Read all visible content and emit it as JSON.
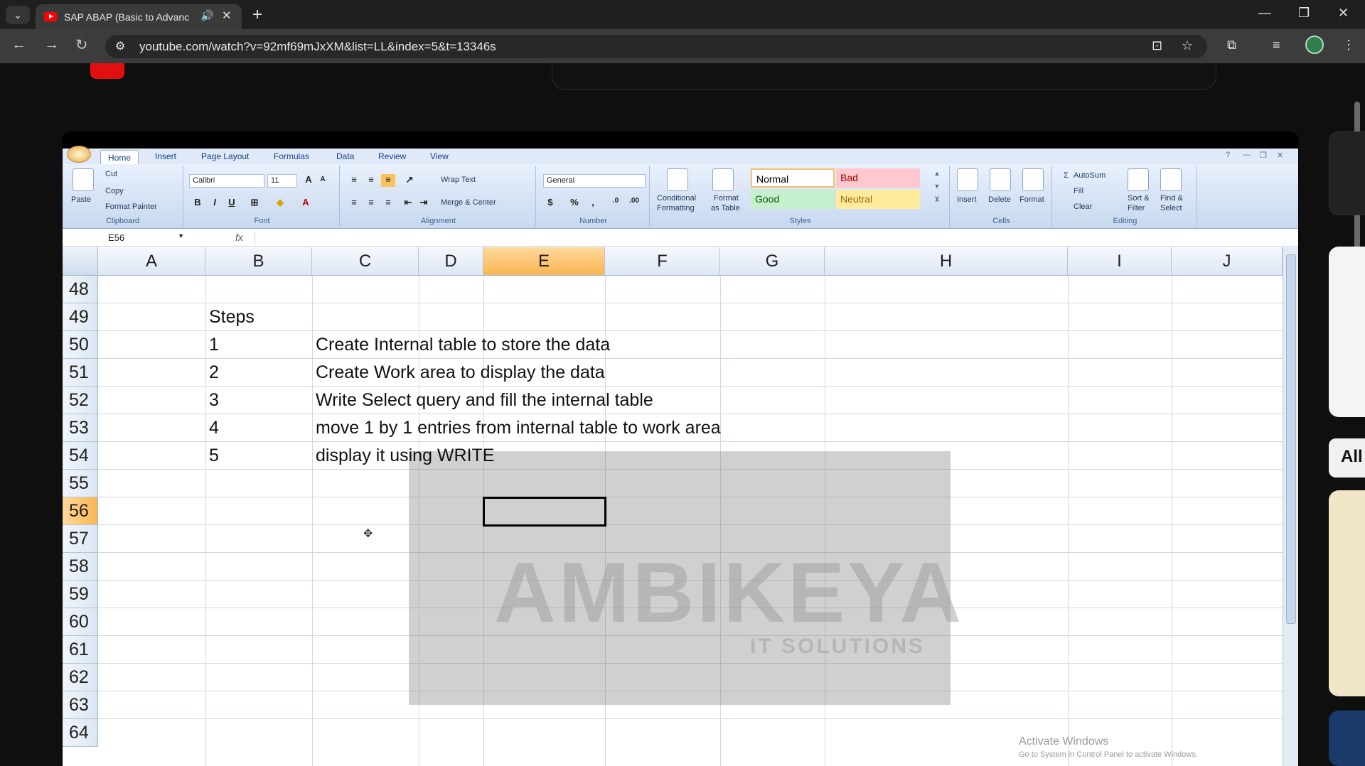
{
  "browser": {
    "tab_title": "SAP ABAP (Basic to Advanc",
    "url": "youtube.com/watch?v=92mf69mJxXM&list=LL&index=5&t=13346s"
  },
  "excel": {
    "tabs": [
      "Home",
      "Insert",
      "Page Layout",
      "Formulas",
      "Data",
      "Review",
      "View"
    ],
    "clipboard": {
      "paste": "Paste",
      "cut": "Cut",
      "copy": "Copy",
      "format_painter": "Format Painter",
      "group": "Clipboard"
    },
    "font": {
      "name": "Calibri",
      "size": "11",
      "group": "Font",
      "bold": "B",
      "italic": "I",
      "underline": "U",
      "grow": "A",
      "shrink": "A",
      "color": "A"
    },
    "alignment": {
      "wrap": "Wrap Text",
      "merge": "Merge & Center",
      "group": "Alignment"
    },
    "number": {
      "format": "General",
      "currency": "$",
      "percent": "%",
      "comma": ",",
      "group": "Number"
    },
    "styles": {
      "cond1": "Conditional",
      "cond2": "Formatting",
      "table1": "Format",
      "table2": "as Table",
      "normal": "Normal",
      "bad": "Bad",
      "good": "Good",
      "neutral": "Neutral",
      "group": "Styles"
    },
    "cells": {
      "insert": "Insert",
      "delete": "Delete",
      "format": "Format",
      "group": "Cells"
    },
    "editing": {
      "autosum": "AutoSum",
      "fill": "Fill",
      "clear": "Clear",
      "sort1": "Sort &",
      "sort2": "Filter",
      "find1": "Find &",
      "find2": "Select",
      "group": "Editing"
    },
    "name_box": "E56",
    "fx": "fx",
    "columns": [
      "A",
      "B",
      "C",
      "D",
      "E",
      "F",
      "G",
      "H",
      "I",
      "J"
    ],
    "rows": [
      "48",
      "49",
      "50",
      "51",
      "52",
      "53",
      "54",
      "55",
      "56",
      "57",
      "58",
      "59",
      "60",
      "61",
      "62",
      "63",
      "64"
    ],
    "selected_column": "E",
    "selected_row": "56",
    "cells_data": {
      "b49": "Steps",
      "b50": "1",
      "c50": "Create Internal table to store the data",
      "b51": "2",
      "c51": "Create Work area to display the data",
      "b52": "3",
      "c52": "Write Select query and fill the internal table",
      "b53": "4",
      "c53": "move 1 by 1 entries from internal table to work area",
      "b54": "5",
      "c54": "display it using WRITE"
    },
    "watermark": "AMBIKEYA",
    "watermark_sub": "IT SOLUTIONS"
  },
  "os": {
    "activate1": "Activate Windows",
    "activate2": "Go to System in Control Panel to activate Windows."
  },
  "sidebar": {
    "chip": "All"
  }
}
